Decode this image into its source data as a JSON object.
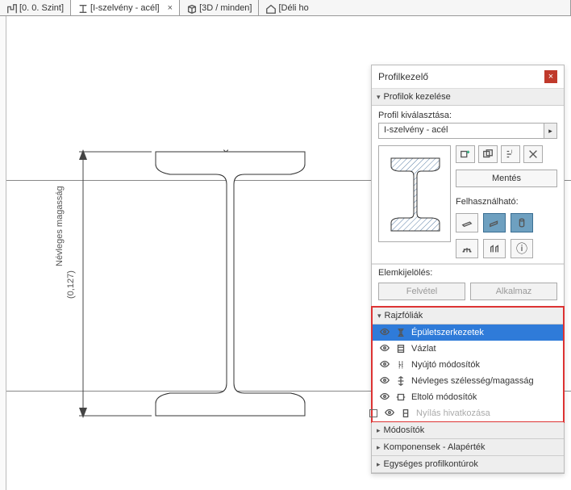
{
  "tabs": [
    {
      "label": "[0. 0. Szint]",
      "active": false
    },
    {
      "label": "[I-szelvény - acél]",
      "active": true,
      "closeable": true
    },
    {
      "label": "[3D / minden]",
      "active": false
    },
    {
      "label": "[Déli ho",
      "active": false
    }
  ],
  "drawing": {
    "nominal_height_label": "Névleges magasság",
    "nominal_height_value": "(0,127)"
  },
  "panel": {
    "title": "Profilkezelő",
    "sections": {
      "manage": {
        "label": "Profilok kezelése",
        "expanded": true
      },
      "modifiers": {
        "label": "Módosítók",
        "expanded": false
      },
      "components": {
        "label": "Komponensek - Alapérték",
        "expanded": false
      },
      "contours": {
        "label": "Egységes profilkontúrok",
        "expanded": false
      }
    },
    "profile_select_label": "Profil kiválasztása:",
    "profile_select_value": "I-szelvény - acél",
    "save_button": "Mentés",
    "usable_label": "Felhasználható:",
    "elem_label": "Elemkijelölés:",
    "pick_button": "Felvétel",
    "apply_button": "Alkalmaz",
    "layers_section": "Rajzfóliák",
    "layers": [
      {
        "label": "Épületszerkezetek",
        "selected": true,
        "visible": true,
        "icon": "beam"
      },
      {
        "label": "Vázlat",
        "selected": false,
        "visible": true,
        "icon": "sketch"
      },
      {
        "label": "Nyújtó módosítók",
        "selected": false,
        "visible": true,
        "icon": "stretch"
      },
      {
        "label": "Névleges szélesség/magasság",
        "selected": false,
        "visible": true,
        "icon": "dim"
      },
      {
        "label": "Eltoló módosítók",
        "selected": false,
        "visible": true,
        "icon": "offset"
      },
      {
        "label": "Nyílás hivatkozása",
        "selected": false,
        "visible": false,
        "icon": "opening",
        "box": true
      }
    ]
  }
}
